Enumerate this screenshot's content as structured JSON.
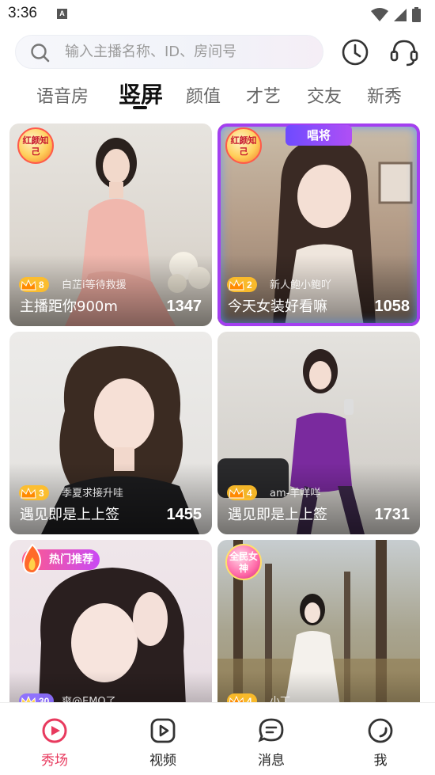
{
  "status": {
    "time": "3:36",
    "notification_letter": "A"
  },
  "search": {
    "placeholder": "输入主播名称、ID、房间号"
  },
  "tabs": [
    {
      "label": "语音房",
      "active": false
    },
    {
      "label": "竖屏",
      "active": true
    },
    {
      "label": "颜值",
      "active": false
    },
    {
      "label": "才艺",
      "active": false
    },
    {
      "label": "交友",
      "active": false
    },
    {
      "label": "新秀",
      "active": false
    }
  ],
  "cards": [
    {
      "tag": "红颜知己",
      "level": "8",
      "anchor": "白芷i等待救援",
      "title": "主播距你900m",
      "count": "1347"
    },
    {
      "tag": "红颜知己",
      "badge": "唱将",
      "level": "2",
      "anchor": "新人鲍小鲍吖",
      "title": "今天女装好看嘛",
      "count": "1058"
    },
    {
      "level": "3",
      "anchor": "季夏求接升哇",
      "title": "遇见即是上上签",
      "count": "1455"
    },
    {
      "level": "4",
      "anchor": "am-羊咩咩",
      "title": "遇见即是上上签",
      "count": "1731"
    },
    {
      "tag": "热门推荐",
      "level": "30",
      "anchor": "爽@EMO了"
    },
    {
      "tag": "全民女神",
      "level": "4",
      "anchor": "小丁"
    }
  ],
  "nav": [
    {
      "label": "秀场",
      "icon": "play-circle-icon",
      "active": true
    },
    {
      "label": "视频",
      "icon": "video-icon",
      "active": false
    },
    {
      "label": "消息",
      "icon": "message-icon",
      "active": false
    },
    {
      "label": "我",
      "icon": "profile-icon",
      "active": false
    }
  ],
  "colors": {
    "accent": "#e83a5e",
    "crown": "#ffbe28"
  }
}
